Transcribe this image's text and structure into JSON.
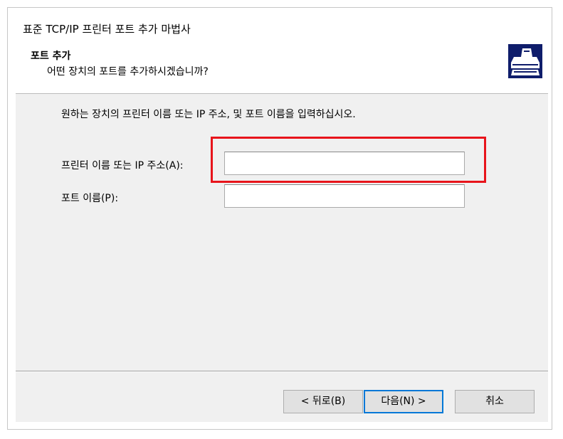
{
  "window": {
    "title": "표준 TCP/IP 프린터 포트 추가 마법사"
  },
  "header": {
    "heading": "포트 추가",
    "subheading": "어떤 장치의 포트를 추가하시겠습니까?",
    "icon": "printer-icon"
  },
  "content": {
    "instruction": "원하는 장치의 프린터 이름 또는 IP 주소, 및 포트 이름을 입력하십시오.",
    "printer_field": {
      "label": "프린터 이름 또는 IP 주소(A):",
      "value": ""
    },
    "port_field": {
      "label": "포트 이름(P):",
      "value": ""
    }
  },
  "buttons": {
    "back": "< 뒤로(B)",
    "next": "다음(N) >",
    "cancel": "취소"
  },
  "colors": {
    "highlight": "#e8141b",
    "icon_bg": "#0f1d6b",
    "default_button_border": "#0078d7"
  }
}
